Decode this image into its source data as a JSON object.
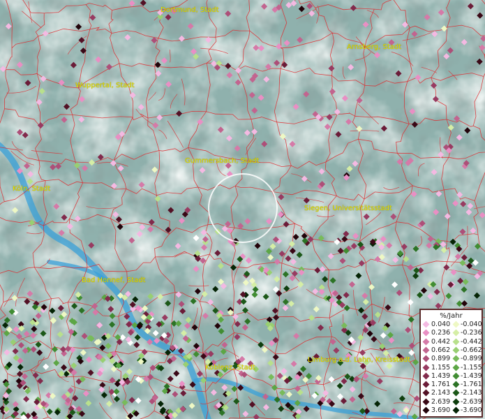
{
  "map": {
    "cities": [
      {
        "name": "Dortmund, Stadt"
      },
      {
        "name": "Arnsberg, Stadt"
      },
      {
        "name": "Wuppertal, Stadt"
      },
      {
        "name": "Gummersbach, Stadt"
      },
      {
        "name": "Köln, Stadt"
      },
      {
        "name": "Siegen, Universitätsstadt"
      },
      {
        "name": "Bad Honnef, Stadt"
      },
      {
        "name": "Koblenz, Stadt"
      },
      {
        "name": "Limburg a.d. Lahn, Kreisstadt"
      }
    ],
    "search_ring": {
      "visible": true
    }
  },
  "legend": {
    "title": "%/Jahr",
    "positive": [
      {
        "value": "0.040",
        "color": "#f4b9e2"
      },
      {
        "value": "0.236",
        "color": "#e98fc4"
      },
      {
        "value": "0.442",
        "color": "#d57aa8"
      },
      {
        "value": "0.662",
        "color": "#c2648f"
      },
      {
        "value": "0.899",
        "color": "#ad4f78"
      },
      {
        "value": "1.155",
        "color": "#983b61"
      },
      {
        "value": "1.439",
        "color": "#822a4c"
      },
      {
        "value": "1.761",
        "color": "#6b1c38"
      },
      {
        "value": "2.143",
        "color": "#531125"
      },
      {
        "value": "2.639",
        "color": "#3a0816"
      },
      {
        "value": "3.690",
        "color": "#22030a"
      }
    ],
    "negative": [
      {
        "value": "-0.040",
        "color": "#eef8c4"
      },
      {
        "value": "-0.236",
        "color": "#d5eea6"
      },
      {
        "value": "-0.442",
        "color": "#b8e08c"
      },
      {
        "value": "-0.662",
        "color": "#98cf72"
      },
      {
        "value": "-0.899",
        "color": "#78bb5a"
      },
      {
        "value": "-1.155",
        "color": "#5ca645"
      },
      {
        "value": "-1.439",
        "color": "#418d33"
      },
      {
        "value": "-1.761",
        "color": "#2c7325"
      },
      {
        "value": "-2.143",
        "color": "#1c5818"
      },
      {
        "value": "-2.639",
        "color": "#0f3e0e"
      },
      {
        "value": "-3.690",
        "color": "#052405"
      }
    ]
  },
  "colors": {
    "terrain": "#8fb1ad",
    "river": "#3aa0d8",
    "boundary": "#e0282c",
    "city_label": "#e7e200"
  }
}
